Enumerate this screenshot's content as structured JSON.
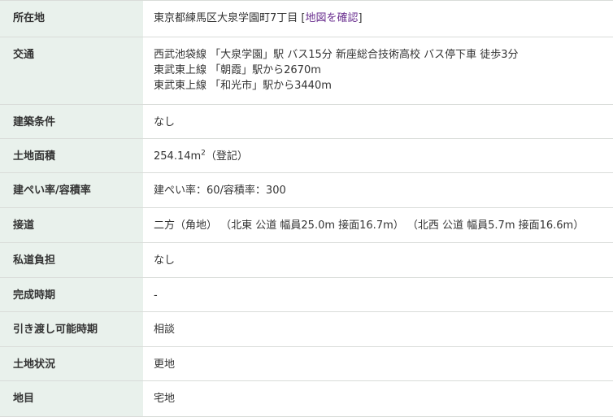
{
  "rows": [
    {
      "label": "所在地",
      "address": "東京都練馬区大泉学園町7丁目",
      "bracket_open": "[",
      "map_link": "地図を確認",
      "bracket_close": "]"
    },
    {
      "label": "交通",
      "lines": [
        "西武池袋線 「大泉学園」駅 バス15分 新座総合技術高校 バス停下車 徒歩3分",
        "東武東上線 「朝霞」駅から2670m",
        "東武東上線 「和光市」駅から3440m"
      ]
    },
    {
      "label": "建築条件",
      "value": "なし"
    },
    {
      "label": "土地面積",
      "value_main": "254.14m",
      "value_sup": "2",
      "value_suffix": "（登記）"
    },
    {
      "label": "建ぺい率/容積率",
      "value": "建ぺい率：60/容積率：300"
    },
    {
      "label": "接道",
      "value": "二方（角地） （北東 公道 幅員25.0m 接面16.7m） （北西 公道 幅員5.7m 接面16.6m）"
    },
    {
      "label": "私道負担",
      "value": "なし"
    },
    {
      "label": "完成時期",
      "value": "-"
    },
    {
      "label": "引き渡し可能時期",
      "value": "相談"
    },
    {
      "label": "土地状況",
      "value": "更地"
    },
    {
      "label": "地目",
      "value": "宅地"
    }
  ]
}
